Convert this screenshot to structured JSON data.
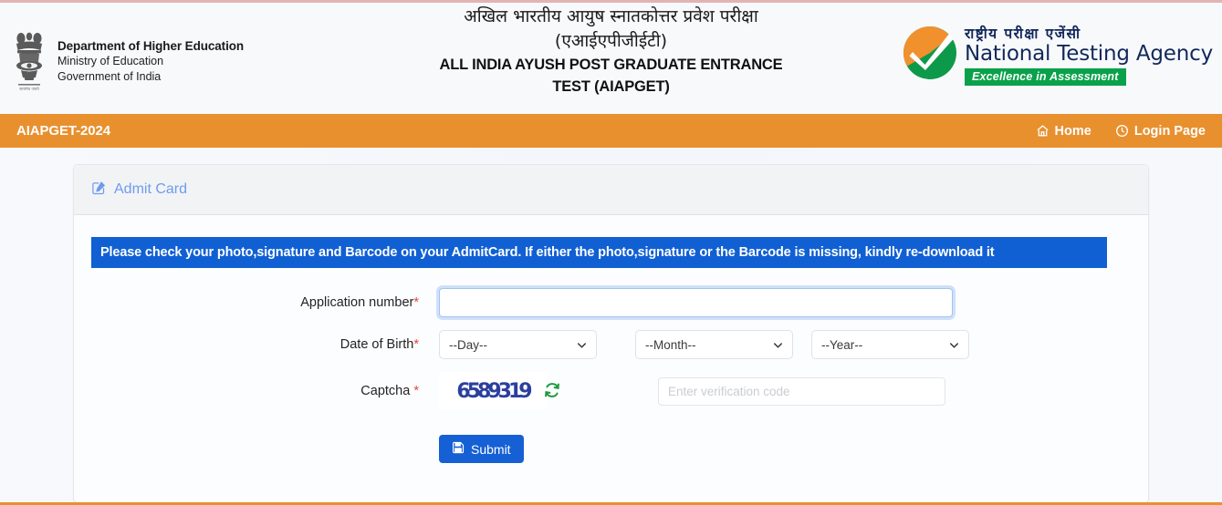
{
  "header": {
    "left": {
      "emblem_icon": "india-state-emblem-icon",
      "line1": "Department of Higher Education",
      "line2": "Ministry of Education",
      "line3": "Government of India"
    },
    "center": {
      "title_hi_line1": "अखिल भारतीय आयुष स्नातकोत्तर प्रवेश परीक्षा",
      "title_hi_line2": "(एआईएपीजीईटी)",
      "title_en_line1": "ALL INDIA AYUSH POST GRADUATE ENTRANCE",
      "title_en_line2": "TEST (AIAPGET)"
    },
    "right": {
      "logo_icon": "nta-checkmark-logo-icon",
      "name_hi": "राष्ट्रीय परीक्षा एजेंसी",
      "name_en": "National Testing Agency",
      "tagline": "Excellence in Assessment"
    }
  },
  "navbar": {
    "brand": "AIAPGET-2024",
    "links": [
      {
        "label": "Home",
        "icon": "home-icon"
      },
      {
        "label": "Login Page",
        "icon": "clock-icon"
      }
    ]
  },
  "card": {
    "header": {
      "icon": "edit-square-icon",
      "title": "Admit Card"
    },
    "alert": "Please check your photo,signature and Barcode on your AdmitCard. If either the photo,signature or the Barcode is missing, kindly re-download it",
    "form": {
      "application_number": {
        "label": "Application number",
        "required_mark": "*",
        "value": "",
        "placeholder": ""
      },
      "date_of_birth": {
        "label": "Date of Birth",
        "required_mark": "*",
        "day": {
          "selected": "--Day--",
          "options": [
            "--Day--"
          ]
        },
        "month": {
          "selected": "--Month--",
          "options": [
            "--Month--"
          ]
        },
        "year": {
          "selected": "--Year--",
          "options": [
            "--Year--"
          ]
        }
      },
      "captcha": {
        "label": "Captcha",
        "required_mark": "*",
        "image_text": "6589319",
        "refresh_icon": "refresh-icon",
        "input_placeholder": "Enter verification code",
        "input_value": ""
      },
      "submit": {
        "label": "Submit",
        "icon": "save-icon"
      }
    }
  },
  "colors": {
    "nav_orange": "#e8902e",
    "alert_blue": "#1060d4",
    "submit_blue": "#1560d4",
    "required_red": "#e8443a",
    "card_title_blue": "#6f9bee",
    "captcha_blue": "#2b3f9e",
    "refresh_green": "#1f9c3f",
    "nta_navy": "#12285a",
    "nta_green": "#0aa14b",
    "top_rule_pink": "#e3b3b3"
  }
}
